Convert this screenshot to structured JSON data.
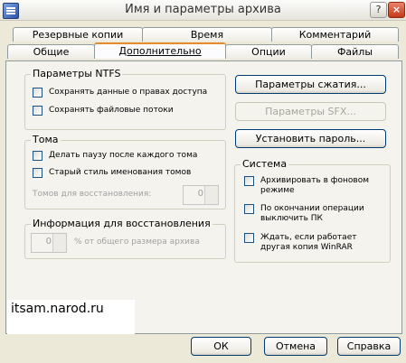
{
  "window": {
    "title": "Имя и параметры архива"
  },
  "tabs_row1": [
    {
      "label": "Резервные копии"
    },
    {
      "label": "Время"
    },
    {
      "label": "Комментарий"
    }
  ],
  "tabs_row2": [
    {
      "label": "Общие"
    },
    {
      "label": "Дополнительно"
    },
    {
      "label": "Опции"
    },
    {
      "label": "Файлы"
    }
  ],
  "ntfs": {
    "title": "Параметры NTFS",
    "save_acl": "Сохранять данные о правах доступа",
    "save_streams": "Сохранять файловые потоки"
  },
  "volumes": {
    "title": "Тома",
    "pause": "Делать паузу после каждого тома",
    "old_style": "Старый стиль именования томов",
    "recovery_label": "Томов для восстановления:",
    "recovery_value": "0"
  },
  "recovery_info": {
    "title": "Информация для восстановления",
    "value": "0",
    "suffix": "% от общего размера архива"
  },
  "buttons": {
    "compression": "Параметры сжатия...",
    "sfx": "Параметры SFX...",
    "password": "Установить пароль..."
  },
  "system": {
    "title": "Система",
    "background": "Архивировать в фоновом режиме",
    "shutdown": "По окончании операции выключить ПК",
    "wait": "Ждать, если работает другая копия WinRAR"
  },
  "watermark": "itsam.narod.ru",
  "footer": {
    "ok": "ОК",
    "cancel": "Отмена",
    "help": "Справка"
  }
}
